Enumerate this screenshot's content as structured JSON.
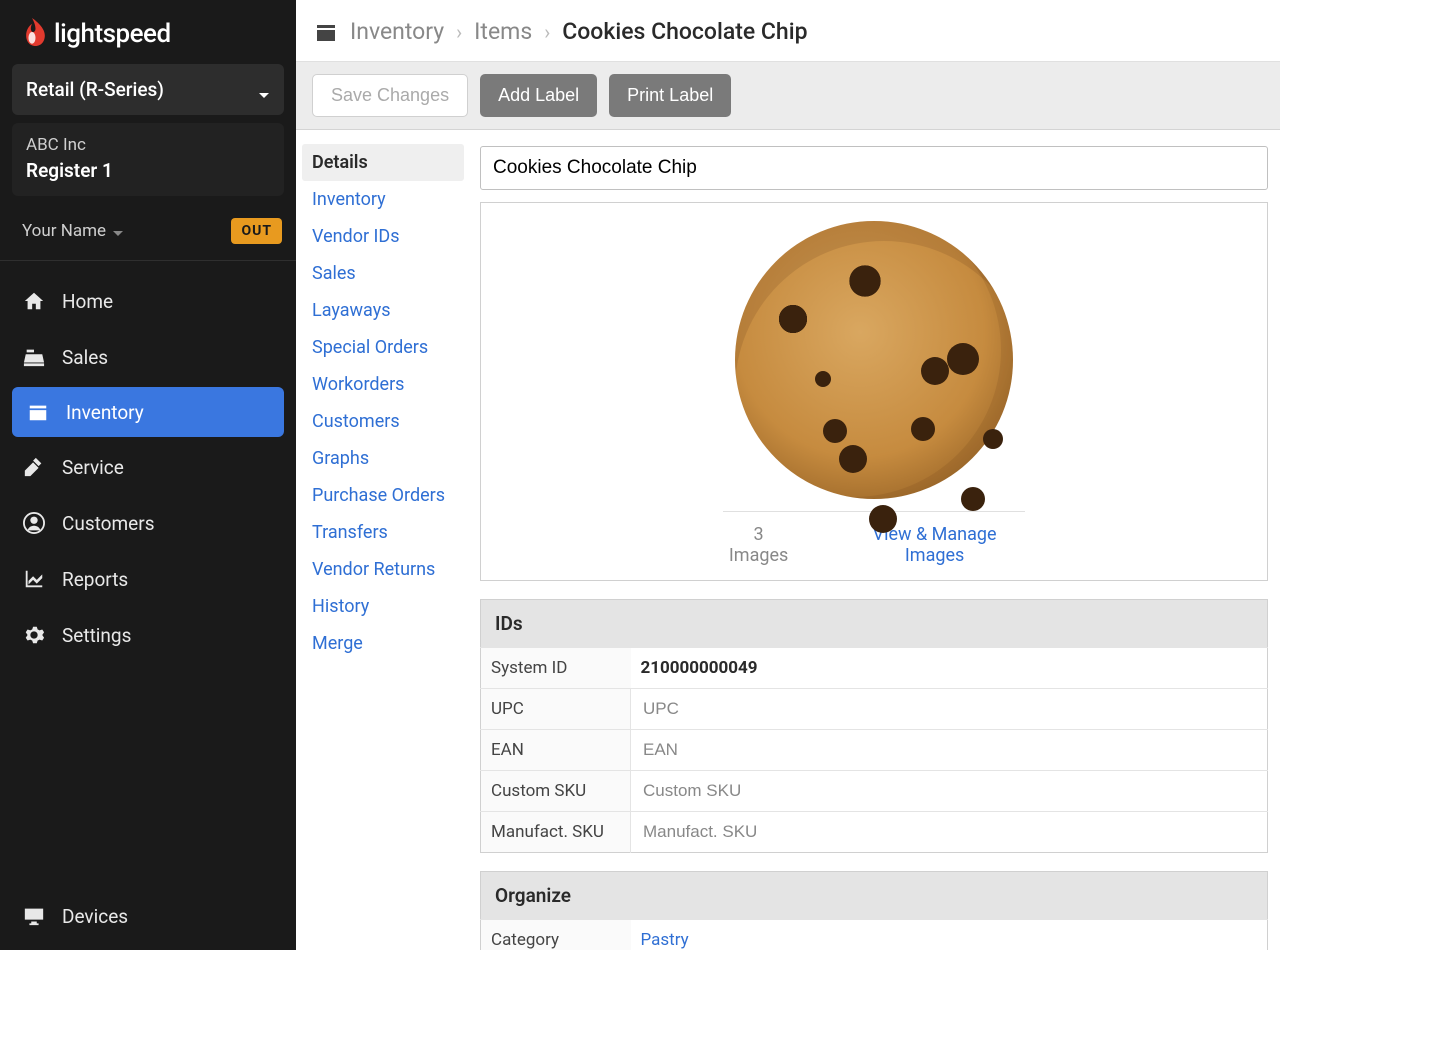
{
  "brand": "lightspeed",
  "series_selector": "Retail (R-Series)",
  "store": {
    "company": "ABC Inc",
    "register": "Register 1"
  },
  "user": {
    "name": "Your Name",
    "punch_status": "OUT"
  },
  "nav": {
    "home": "Home",
    "sales": "Sales",
    "inventory": "Inventory",
    "service": "Service",
    "customers": "Customers",
    "reports": "Reports",
    "settings": "Settings",
    "devices": "Devices"
  },
  "breadcrumb": {
    "l1": "Inventory",
    "l2": "Items",
    "current": "Cookies Chocolate Chip"
  },
  "toolbar": {
    "save": "Save Changes",
    "add_label": "Add Label",
    "print_label": "Print Label"
  },
  "subnav": {
    "details": "Details",
    "inventory": "Inventory",
    "vendor_ids": "Vendor IDs",
    "sales": "Sales",
    "layaways": "Layaways",
    "special_orders": "Special Orders",
    "workorders": "Workorders",
    "customers": "Customers",
    "graphs": "Graphs",
    "purchase_orders": "Purchase Orders",
    "transfers": "Transfers",
    "vendor_returns": "Vendor Returns",
    "history": "History",
    "merge": "Merge"
  },
  "item": {
    "name": "Cookies Chocolate Chip",
    "image_count": "3 Images",
    "manage_images": "View & Manage Images"
  },
  "sections": {
    "ids": "IDs",
    "organize": "Organize"
  },
  "ids": {
    "system_id_label": "System ID",
    "system_id_value": "210000000049",
    "upc_label": "UPC",
    "upc_placeholder": "UPC",
    "ean_label": "EAN",
    "ean_placeholder": "EAN",
    "custom_sku_label": "Custom SKU",
    "custom_sku_placeholder": "Custom SKU",
    "manuf_sku_label": "Manufact. SKU",
    "manuf_sku_placeholder": "Manufact. SKU"
  },
  "organize": {
    "category_label": "Category",
    "category_value": "Pastry"
  }
}
